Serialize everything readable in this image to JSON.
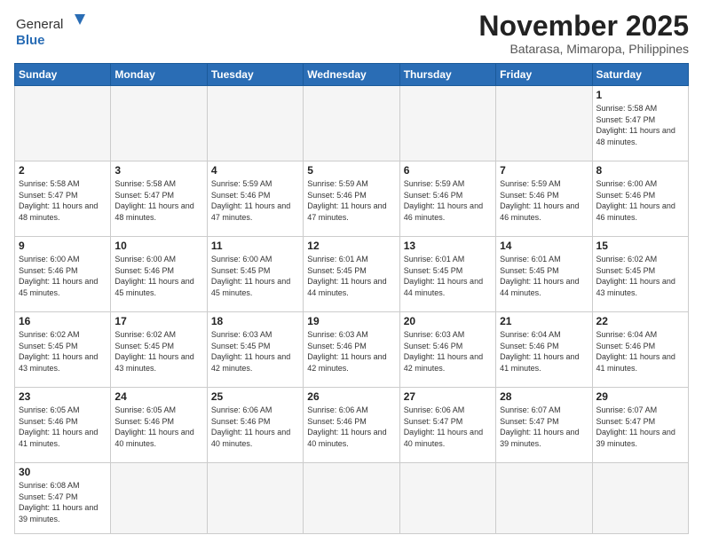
{
  "header": {
    "logo_general": "General",
    "logo_blue": "Blue",
    "month_title": "November 2025",
    "subtitle": "Batarasa, Mimaropa, Philippines"
  },
  "weekdays": [
    "Sunday",
    "Monday",
    "Tuesday",
    "Wednesday",
    "Thursday",
    "Friday",
    "Saturday"
  ],
  "days": [
    {
      "num": "",
      "sunrise": "",
      "sunset": "",
      "daylight": "",
      "empty": true
    },
    {
      "num": "",
      "sunrise": "",
      "sunset": "",
      "daylight": "",
      "empty": true
    },
    {
      "num": "",
      "sunrise": "",
      "sunset": "",
      "daylight": "",
      "empty": true
    },
    {
      "num": "",
      "sunrise": "",
      "sunset": "",
      "daylight": "",
      "empty": true
    },
    {
      "num": "",
      "sunrise": "",
      "sunset": "",
      "daylight": "",
      "empty": true
    },
    {
      "num": "",
      "sunrise": "",
      "sunset": "",
      "daylight": "",
      "empty": true
    },
    {
      "num": "1",
      "sunrise": "Sunrise: 5:58 AM",
      "sunset": "Sunset: 5:47 PM",
      "daylight": "Daylight: 11 hours and 48 minutes.",
      "empty": false
    },
    {
      "num": "2",
      "sunrise": "Sunrise: 5:58 AM",
      "sunset": "Sunset: 5:47 PM",
      "daylight": "Daylight: 11 hours and 48 minutes.",
      "empty": false
    },
    {
      "num": "3",
      "sunrise": "Sunrise: 5:58 AM",
      "sunset": "Sunset: 5:47 PM",
      "daylight": "Daylight: 11 hours and 48 minutes.",
      "empty": false
    },
    {
      "num": "4",
      "sunrise": "Sunrise: 5:59 AM",
      "sunset": "Sunset: 5:46 PM",
      "daylight": "Daylight: 11 hours and 47 minutes.",
      "empty": false
    },
    {
      "num": "5",
      "sunrise": "Sunrise: 5:59 AM",
      "sunset": "Sunset: 5:46 PM",
      "daylight": "Daylight: 11 hours and 47 minutes.",
      "empty": false
    },
    {
      "num": "6",
      "sunrise": "Sunrise: 5:59 AM",
      "sunset": "Sunset: 5:46 PM",
      "daylight": "Daylight: 11 hours and 46 minutes.",
      "empty": false
    },
    {
      "num": "7",
      "sunrise": "Sunrise: 5:59 AM",
      "sunset": "Sunset: 5:46 PM",
      "daylight": "Daylight: 11 hours and 46 minutes.",
      "empty": false
    },
    {
      "num": "8",
      "sunrise": "Sunrise: 6:00 AM",
      "sunset": "Sunset: 5:46 PM",
      "daylight": "Daylight: 11 hours and 46 minutes.",
      "empty": false
    },
    {
      "num": "9",
      "sunrise": "Sunrise: 6:00 AM",
      "sunset": "Sunset: 5:46 PM",
      "daylight": "Daylight: 11 hours and 45 minutes.",
      "empty": false
    },
    {
      "num": "10",
      "sunrise": "Sunrise: 6:00 AM",
      "sunset": "Sunset: 5:46 PM",
      "daylight": "Daylight: 11 hours and 45 minutes.",
      "empty": false
    },
    {
      "num": "11",
      "sunrise": "Sunrise: 6:00 AM",
      "sunset": "Sunset: 5:45 PM",
      "daylight": "Daylight: 11 hours and 45 minutes.",
      "empty": false
    },
    {
      "num": "12",
      "sunrise": "Sunrise: 6:01 AM",
      "sunset": "Sunset: 5:45 PM",
      "daylight": "Daylight: 11 hours and 44 minutes.",
      "empty": false
    },
    {
      "num": "13",
      "sunrise": "Sunrise: 6:01 AM",
      "sunset": "Sunset: 5:45 PM",
      "daylight": "Daylight: 11 hours and 44 minutes.",
      "empty": false
    },
    {
      "num": "14",
      "sunrise": "Sunrise: 6:01 AM",
      "sunset": "Sunset: 5:45 PM",
      "daylight": "Daylight: 11 hours and 44 minutes.",
      "empty": false
    },
    {
      "num": "15",
      "sunrise": "Sunrise: 6:02 AM",
      "sunset": "Sunset: 5:45 PM",
      "daylight": "Daylight: 11 hours and 43 minutes.",
      "empty": false
    },
    {
      "num": "16",
      "sunrise": "Sunrise: 6:02 AM",
      "sunset": "Sunset: 5:45 PM",
      "daylight": "Daylight: 11 hours and 43 minutes.",
      "empty": false
    },
    {
      "num": "17",
      "sunrise": "Sunrise: 6:02 AM",
      "sunset": "Sunset: 5:45 PM",
      "daylight": "Daylight: 11 hours and 43 minutes.",
      "empty": false
    },
    {
      "num": "18",
      "sunrise": "Sunrise: 6:03 AM",
      "sunset": "Sunset: 5:45 PM",
      "daylight": "Daylight: 11 hours and 42 minutes.",
      "empty": false
    },
    {
      "num": "19",
      "sunrise": "Sunrise: 6:03 AM",
      "sunset": "Sunset: 5:46 PM",
      "daylight": "Daylight: 11 hours and 42 minutes.",
      "empty": false
    },
    {
      "num": "20",
      "sunrise": "Sunrise: 6:03 AM",
      "sunset": "Sunset: 5:46 PM",
      "daylight": "Daylight: 11 hours and 42 minutes.",
      "empty": false
    },
    {
      "num": "21",
      "sunrise": "Sunrise: 6:04 AM",
      "sunset": "Sunset: 5:46 PM",
      "daylight": "Daylight: 11 hours and 41 minutes.",
      "empty": false
    },
    {
      "num": "22",
      "sunrise": "Sunrise: 6:04 AM",
      "sunset": "Sunset: 5:46 PM",
      "daylight": "Daylight: 11 hours and 41 minutes.",
      "empty": false
    },
    {
      "num": "23",
      "sunrise": "Sunrise: 6:05 AM",
      "sunset": "Sunset: 5:46 PM",
      "daylight": "Daylight: 11 hours and 41 minutes.",
      "empty": false
    },
    {
      "num": "24",
      "sunrise": "Sunrise: 6:05 AM",
      "sunset": "Sunset: 5:46 PM",
      "daylight": "Daylight: 11 hours and 40 minutes.",
      "empty": false
    },
    {
      "num": "25",
      "sunrise": "Sunrise: 6:06 AM",
      "sunset": "Sunset: 5:46 PM",
      "daylight": "Daylight: 11 hours and 40 minutes.",
      "empty": false
    },
    {
      "num": "26",
      "sunrise": "Sunrise: 6:06 AM",
      "sunset": "Sunset: 5:46 PM",
      "daylight": "Daylight: 11 hours and 40 minutes.",
      "empty": false
    },
    {
      "num": "27",
      "sunrise": "Sunrise: 6:06 AM",
      "sunset": "Sunset: 5:47 PM",
      "daylight": "Daylight: 11 hours and 40 minutes.",
      "empty": false
    },
    {
      "num": "28",
      "sunrise": "Sunrise: 6:07 AM",
      "sunset": "Sunset: 5:47 PM",
      "daylight": "Daylight: 11 hours and 39 minutes.",
      "empty": false
    },
    {
      "num": "29",
      "sunrise": "Sunrise: 6:07 AM",
      "sunset": "Sunset: 5:47 PM",
      "daylight": "Daylight: 11 hours and 39 minutes.",
      "empty": false
    },
    {
      "num": "30",
      "sunrise": "Sunrise: 6:08 AM",
      "sunset": "Sunset: 5:47 PM",
      "daylight": "Daylight: 11 hours and 39 minutes.",
      "empty": false
    },
    {
      "num": "",
      "sunrise": "",
      "sunset": "",
      "daylight": "",
      "empty": true
    },
    {
      "num": "",
      "sunrise": "",
      "sunset": "",
      "daylight": "",
      "empty": true
    },
    {
      "num": "",
      "sunrise": "",
      "sunset": "",
      "daylight": "",
      "empty": true
    },
    {
      "num": "",
      "sunrise": "",
      "sunset": "",
      "daylight": "",
      "empty": true
    },
    {
      "num": "",
      "sunrise": "",
      "sunset": "",
      "daylight": "",
      "empty": true
    },
    {
      "num": "",
      "sunrise": "",
      "sunset": "",
      "daylight": "",
      "empty": true
    }
  ]
}
